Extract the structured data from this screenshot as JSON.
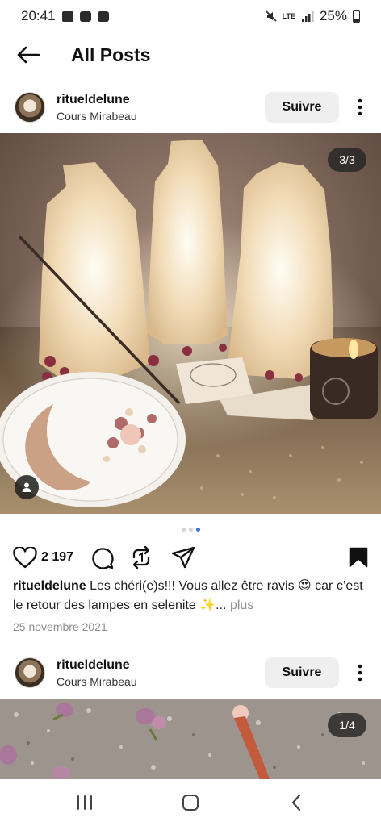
{
  "status_bar": {
    "time": "20:41",
    "battery": "25%",
    "network": "LTE"
  },
  "header": {
    "title": "All Posts"
  },
  "posts": [
    {
      "username": "ritueldelune",
      "location": "Cours Mirabeau",
      "follow_label": "Suivre",
      "media_counter": "3/3",
      "carousel": {
        "count": 3,
        "active_index": 2
      },
      "likes": "2 197",
      "caption_user": "ritueldelune",
      "caption_text": " Les chéri(e)s!!! Vous allez être ravis 😍 car c’est le retour des lampes en selenite ✨...",
      "caption_more": " plus",
      "date": "25 novembre 2021"
    },
    {
      "username": "ritueldelune",
      "location": "Cours Mirabeau",
      "follow_label": "Suivre",
      "media_counter": "1/4"
    }
  ],
  "icons": {
    "back": "back-arrow-icon",
    "more": "more-vertical-icon",
    "like": "heart-icon",
    "comment": "comment-icon",
    "repost": "repost-icon",
    "share": "share-icon",
    "save": "bookmark-icon",
    "tag": "user-tag-icon",
    "nav_recent": "recent-apps-icon",
    "nav_home": "home-icon",
    "nav_back": "nav-back-icon"
  },
  "colors": {
    "active_dot": "#3b6fe0",
    "follow_bg": "#efefef"
  }
}
